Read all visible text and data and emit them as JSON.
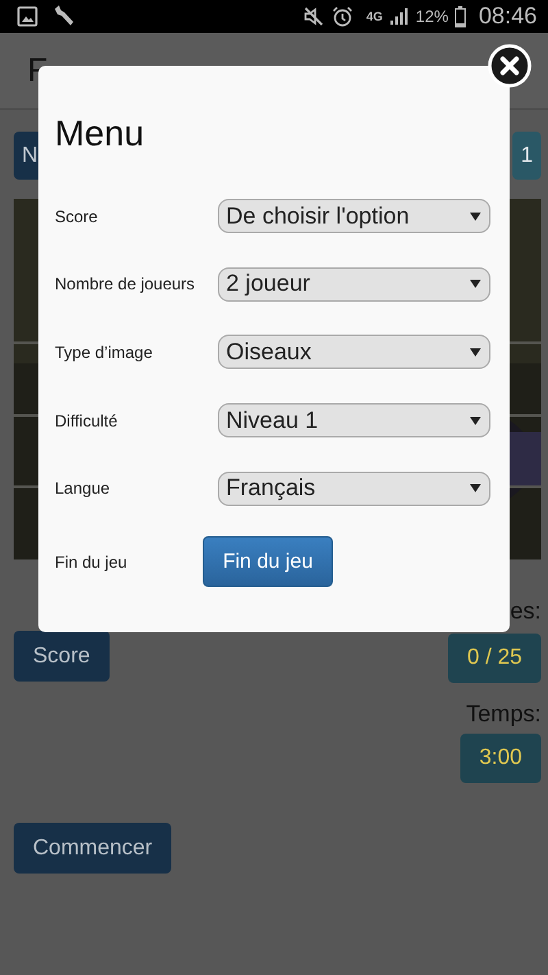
{
  "status_bar": {
    "network": "4G",
    "battery": "12%",
    "time": "08:46"
  },
  "header": {
    "title": "F"
  },
  "top_buttons": [
    {
      "label": "N",
      "kind": "primary"
    },
    {
      "label": "1",
      "kind": "info"
    }
  ],
  "score_button": "Score",
  "moves": {
    "label": "es:",
    "value": "0 / 25"
  },
  "timer": {
    "label": "Temps:",
    "value": "3:00"
  },
  "start_button": "Commencer",
  "modal": {
    "title": "Menu",
    "fields": [
      {
        "kind": "select",
        "label": "Score",
        "value": "De choisir l'option"
      },
      {
        "kind": "select",
        "label": "Nombre de joueurs",
        "value": "2 joueur"
      },
      {
        "kind": "select",
        "label": "Type d’image",
        "value": "Oiseaux"
      },
      {
        "kind": "select",
        "label": "Difficulté",
        "value": "Niveau 1"
      },
      {
        "kind": "select",
        "label": "Langue",
        "value": "Français"
      },
      {
        "kind": "button",
        "label": "Fin du jeu",
        "button": "Fin du jeu"
      }
    ]
  }
}
